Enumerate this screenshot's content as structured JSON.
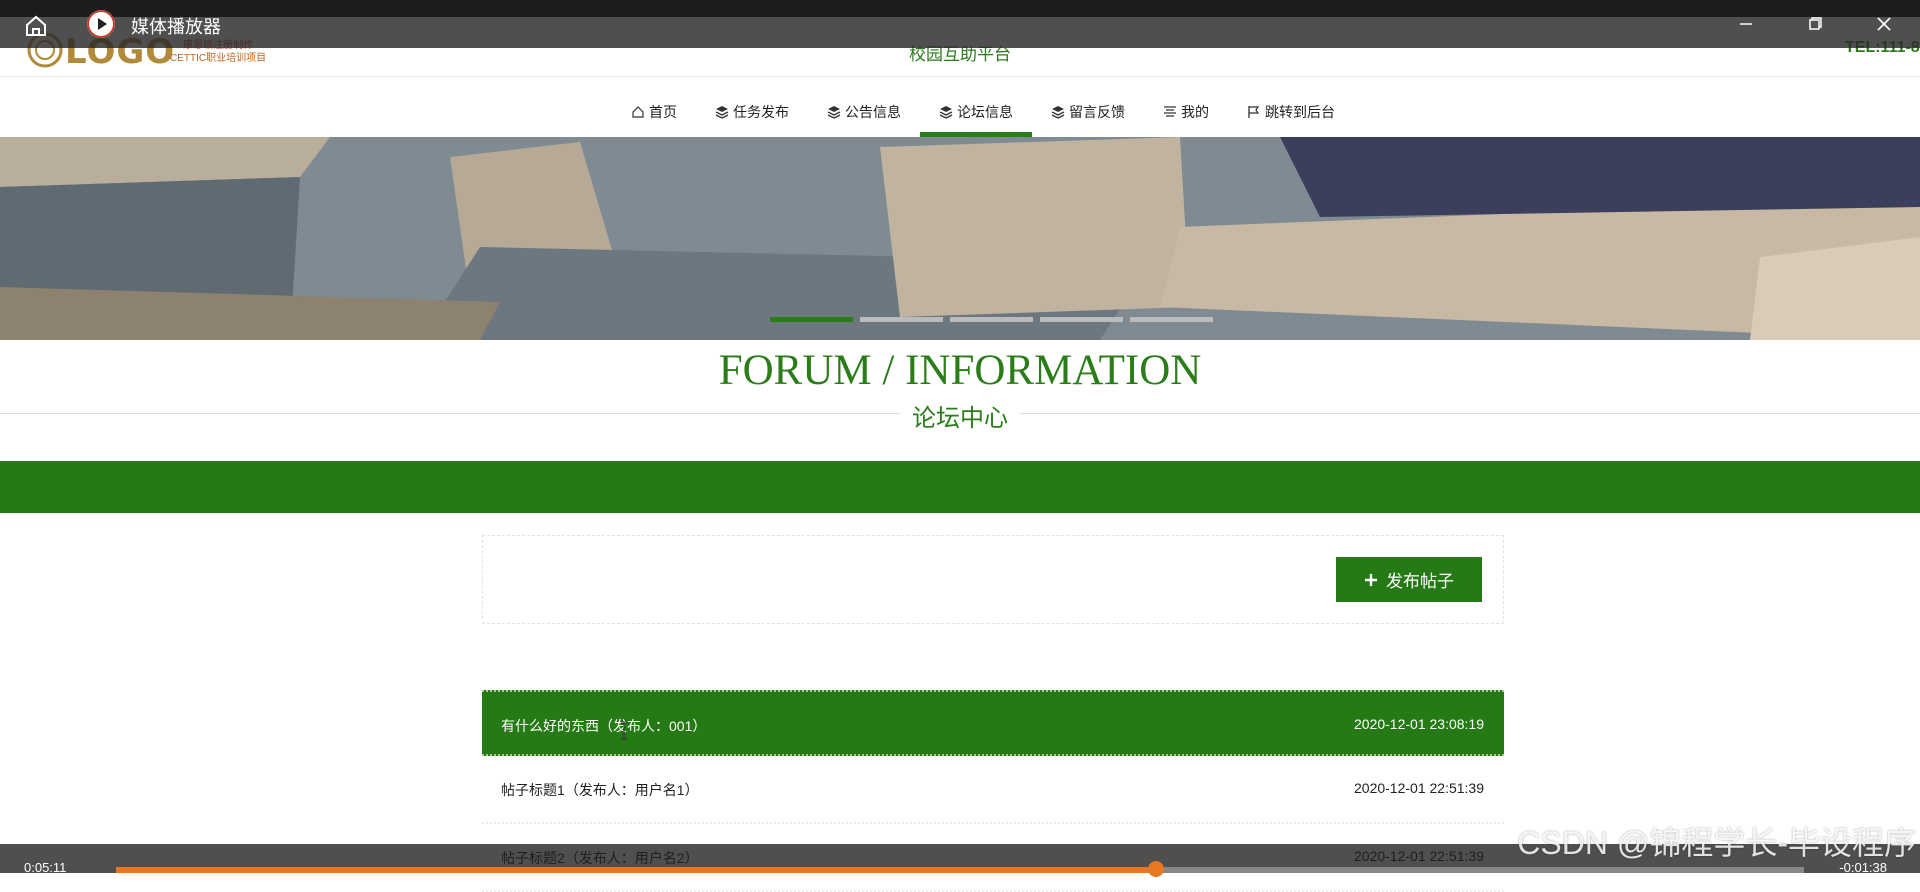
{
  "player": {
    "title": "媒体播放器",
    "current_time": "0:05:11",
    "remaining_time": "-0:01:38",
    "progress": 0.616,
    "accent": "#e87722"
  },
  "site": {
    "logo_text": "LOGO",
    "logo_sub1": "· 康思顿注册制作 ·",
    "logo_sub2": "CETTIC职业培训项目",
    "name": "校园互助平台",
    "tel": "TEL:111-8",
    "brand_color": "#267a16"
  },
  "nav": {
    "items": [
      {
        "label": "首页",
        "icon": "home-icon"
      },
      {
        "label": "任务发布",
        "icon": "layers-icon"
      },
      {
        "label": "公告信息",
        "icon": "layers-icon"
      },
      {
        "label": "论坛信息",
        "icon": "layers-icon"
      },
      {
        "label": "留言反馈",
        "icon": "layers-icon"
      },
      {
        "label": "我的",
        "icon": "list-icon"
      },
      {
        "label": "跳转到后台",
        "icon": "flag-icon"
      }
    ],
    "active_index": 3
  },
  "banner": {
    "slides": 5,
    "active_slide": 0
  },
  "section": {
    "title": "FORUM / INFORMATION",
    "subtitle": "论坛中心"
  },
  "toolbar": {
    "post_label": "发布帖子"
  },
  "posts": [
    {
      "title": "有什么好的东西（发布人：001）",
      "date": "2020-12-01 23:08:19",
      "highlight": true
    },
    {
      "title": "帖子标题1（发布人：用户名1）",
      "date": "2020-12-01 22:51:39",
      "highlight": false
    },
    {
      "title": "帖子标题2（发布人：用户名2）",
      "date": "2020-12-01 22:51:39",
      "highlight": false
    }
  ],
  "watermark": "CSDN @锦程学长-毕设程序"
}
